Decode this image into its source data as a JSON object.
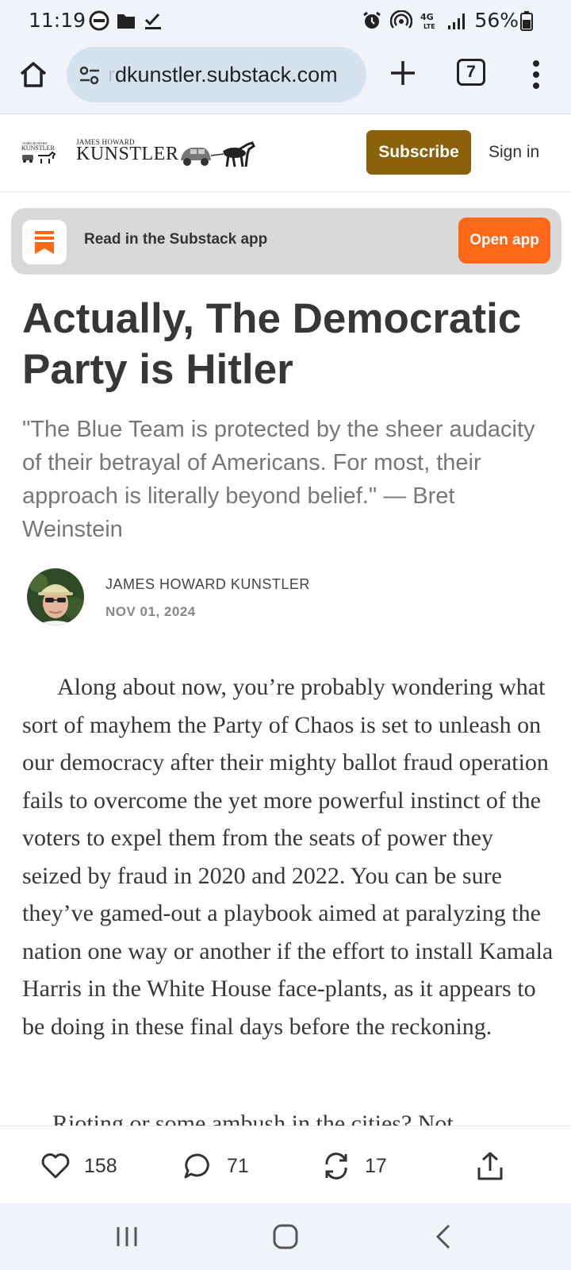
{
  "status_bar": {
    "time": "11:19",
    "battery": "56%",
    "network": "4G LTE"
  },
  "browser": {
    "url_faded": "r",
    "url_domain": "dkunstler.substack.com",
    "tab_count": "7"
  },
  "site_header": {
    "logo_tag": "JAMES HOWARD",
    "logo_name": "KUNSTLER",
    "subscribe_label": "Subscribe",
    "signin_label": "Sign in",
    "brand_color": "#8a6008"
  },
  "app_banner": {
    "text": "Read in the Substack app",
    "open_label": "Open app",
    "accent_color": "#ff6719"
  },
  "article": {
    "title": "Actually, The Democratic Party is Hitler",
    "subtitle": "\"The Blue Team is protected by the sheer audacity of their betrayal of Americans. For most, their approach is literally beyond belief.\" — Bret Weinstein",
    "author": "JAMES HOWARD KUNSTLER",
    "date": "NOV 01, 2024",
    "body_paragraph": "Along about now, you’re probably wondering what sort of mayhem the Party of Chaos is set to unleash on our democracy after their mighty ballot fraud operation fails to overcome the yet more powerful instinct of the voters to expel them from the seats of power they seized by fraud in 2020 and 2022. You can be sure they’ve gamed-out a playbook aimed at paralyzing the nation one way or another if the effort to install Kamala Harris in the White House face-plants, as it appears to be doing in these final days before the reckoning.",
    "next_paragraph_peek": "Rioting or some ambush in the cities? Not"
  },
  "engagement": {
    "likes": "158",
    "comments": "71",
    "restacks": "17"
  },
  "icons": {
    "home": "home-icon",
    "site_settings": "tune-icon",
    "new_tab": "plus-icon",
    "menu": "more-vert-icon",
    "like": "heart-icon",
    "comment": "comment-icon",
    "restack": "restack-icon",
    "share": "share-icon",
    "nav_recents": "recents-icon",
    "nav_home": "nav-home-icon",
    "nav_back": "back-icon"
  }
}
